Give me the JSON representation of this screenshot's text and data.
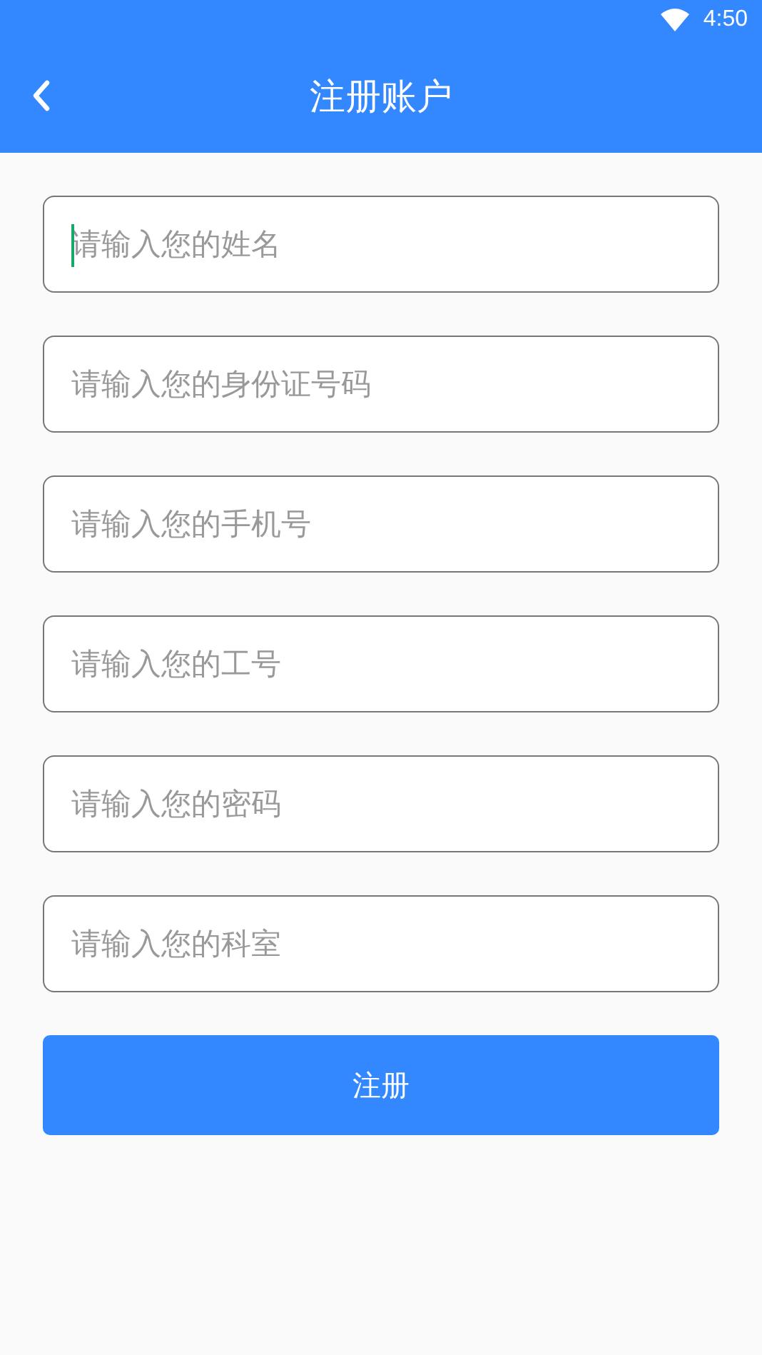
{
  "status_bar": {
    "time": "4:50"
  },
  "header": {
    "title": "注册账户"
  },
  "fields": [
    {
      "placeholder": "请输入您的姓名",
      "focused": true
    },
    {
      "placeholder": "请输入您的身份证号码",
      "focused": false
    },
    {
      "placeholder": "请输入您的手机号",
      "focused": false
    },
    {
      "placeholder": "请输入您的工号",
      "focused": false
    },
    {
      "placeholder": "请输入您的密码",
      "focused": false
    },
    {
      "placeholder": "请输入您的科室",
      "focused": false
    }
  ],
  "submit": {
    "label": "注册"
  }
}
